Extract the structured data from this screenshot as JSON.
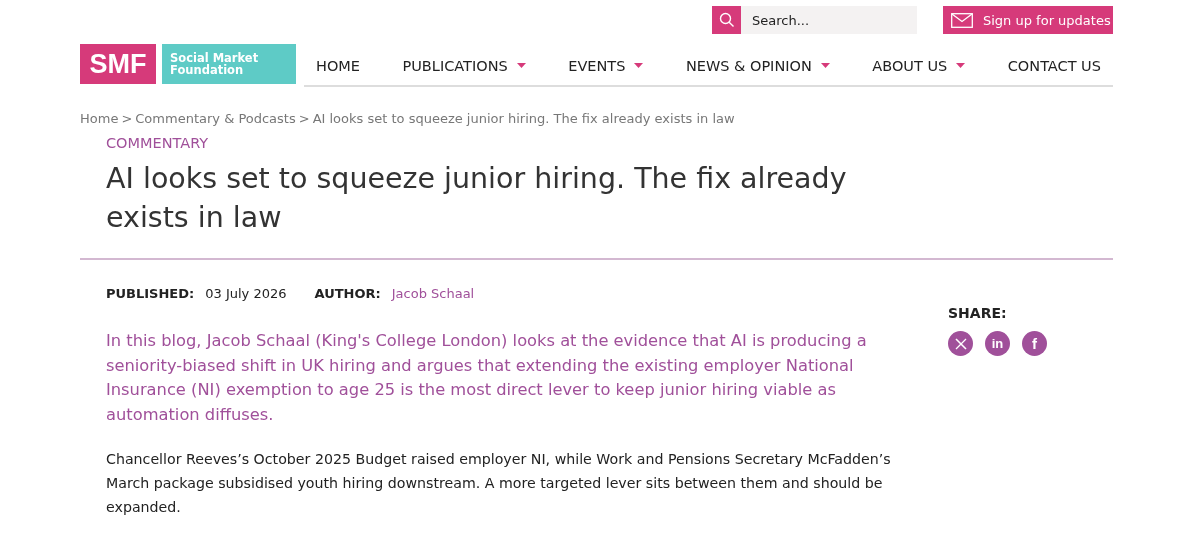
{
  "search": {
    "placeholder": "Search..."
  },
  "signup_button": {
    "label": "Sign up for updates"
  },
  "logo": {
    "mark": "SMF",
    "name_line_1": "Social Market",
    "name_line_2": "Foundation"
  },
  "nav": [
    {
      "label": "HOME",
      "has_dropdown": false
    },
    {
      "label": "PUBLICATIONS",
      "has_dropdown": true
    },
    {
      "label": "EVENTS",
      "has_dropdown": true
    },
    {
      "label": "NEWS & OPINION",
      "has_dropdown": true
    },
    {
      "label": "ABOUT US",
      "has_dropdown": true
    },
    {
      "label": "CONTACT US",
      "has_dropdown": false
    }
  ],
  "breadcrumb": [
    "Home",
    "Commentary & Podcasts",
    "AI looks set to squeeze junior hiring. The fix already exists in law"
  ],
  "breadcrumb_separator": ">",
  "article": {
    "category": "COMMENTARY",
    "title": "AI looks set to squeeze junior hiring. The fix already exists in law",
    "published_label": "PUBLISHED:",
    "published": "03 July 2026",
    "author_label": "AUTHOR:",
    "author": "Jacob Schaal",
    "lede": "In this blog, Jacob Schaal (King's College London) looks at the evidence that AI is producing a seniority-biased shift in UK hiring and argues that extending the existing employer National Insurance (NI) exemption to age 25 is the most direct lever to keep junior hiring viable as automation diffuses.",
    "body": [
      "Chancellor Reeves’s October 2025 Budget raised employer NI, while Work and Pensions Secretary McFadden’s March package subsidised youth hiring downstream. A more targeted lever sits between them and should be expanded."
    ]
  },
  "share": {
    "label": "SHARE:",
    "buttons": [
      {
        "kind": "x"
      },
      {
        "kind": "linkedin",
        "label": "in"
      },
      {
        "kind": "facebook",
        "label": "f"
      }
    ]
  }
}
